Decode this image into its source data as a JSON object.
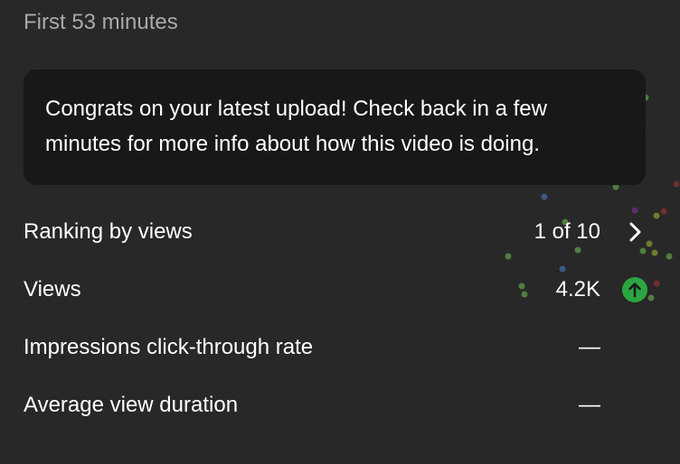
{
  "period_label": "First 53 minutes",
  "banner": {
    "message": "Congrats on your latest upload! Check back in a few minutes for more info about how this video is doing."
  },
  "metrics": [
    {
      "label": "Ranking by views",
      "value": "1 of 10",
      "trail_icon": "chevron-right-icon"
    },
    {
      "label": "Views",
      "value": "4.2K",
      "trail_icon": "arrow-up-circle-icon"
    },
    {
      "label": "Impressions click-through rate",
      "value": "—"
    },
    {
      "label": "Average view duration",
      "value": "—"
    }
  ],
  "colors": {
    "background": "#282828",
    "banner_background": "#181818",
    "muted_text": "#aaaaaa",
    "trend_up": "#2ba640"
  }
}
